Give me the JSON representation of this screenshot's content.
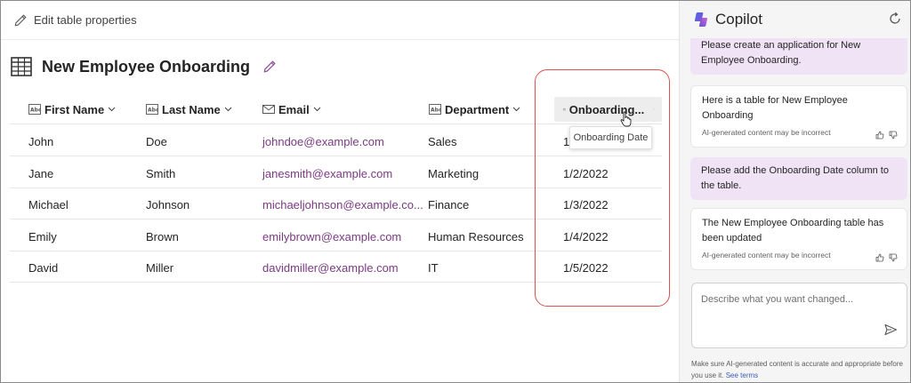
{
  "toolbar": {
    "edit_label": "Edit table properties"
  },
  "table": {
    "title": "New Employee Onboarding",
    "columns": [
      {
        "label": "First Name",
        "icon": "text-abc-icon"
      },
      {
        "label": "Last Name",
        "icon": "text-abc-icon"
      },
      {
        "label": "Email",
        "icon": "mail-icon"
      },
      {
        "label": "Department",
        "icon": "text-abc-icon"
      },
      {
        "label": "Onboarding...",
        "icon": "calendar-icon"
      }
    ],
    "rows": [
      {
        "first": "John",
        "last": "Doe",
        "email": "johndoe@example.com",
        "dept": "Sales",
        "date": "1/"
      },
      {
        "first": "Jane",
        "last": "Smith",
        "email": "janesmith@example.com",
        "dept": "Marketing",
        "date": "1/2/2022"
      },
      {
        "first": "Michael",
        "last": "Johnson",
        "email": "michaeljohnson@example.co...",
        "dept": "Finance",
        "date": "1/3/2022"
      },
      {
        "first": "Emily",
        "last": "Brown",
        "email": "emilybrown@example.com",
        "dept": "Human Resources",
        "date": "1/4/2022"
      },
      {
        "first": "David",
        "last": "Miller",
        "email": "davidmiller@example.com",
        "dept": "IT",
        "date": "1/5/2022"
      }
    ],
    "tooltip": "Onboarding Date"
  },
  "copilot": {
    "title": "Copilot",
    "messages": [
      {
        "role": "user",
        "text": "Please create an application for New Employee Onboarding."
      },
      {
        "role": "ai",
        "text": "Here is a table for New Employee Onboarding",
        "disclaimer": "AI-generated content may be incorrect"
      },
      {
        "role": "user",
        "text": "Please add the Onboarding Date column to the table."
      },
      {
        "role": "ai",
        "text": "The New Employee Onboarding table has been updated",
        "disclaimer": "AI-generated content may be incorrect"
      }
    ],
    "input_placeholder": "Describe what you want changed...",
    "footer_text": "Make sure AI-generated content is accurate and appropriate before you use it.",
    "footer_link": "See terms"
  },
  "colors": {
    "accent_purple": "#7a3a82",
    "user_bubble": "#f1e3f6",
    "highlight_red": "#d9534f"
  }
}
